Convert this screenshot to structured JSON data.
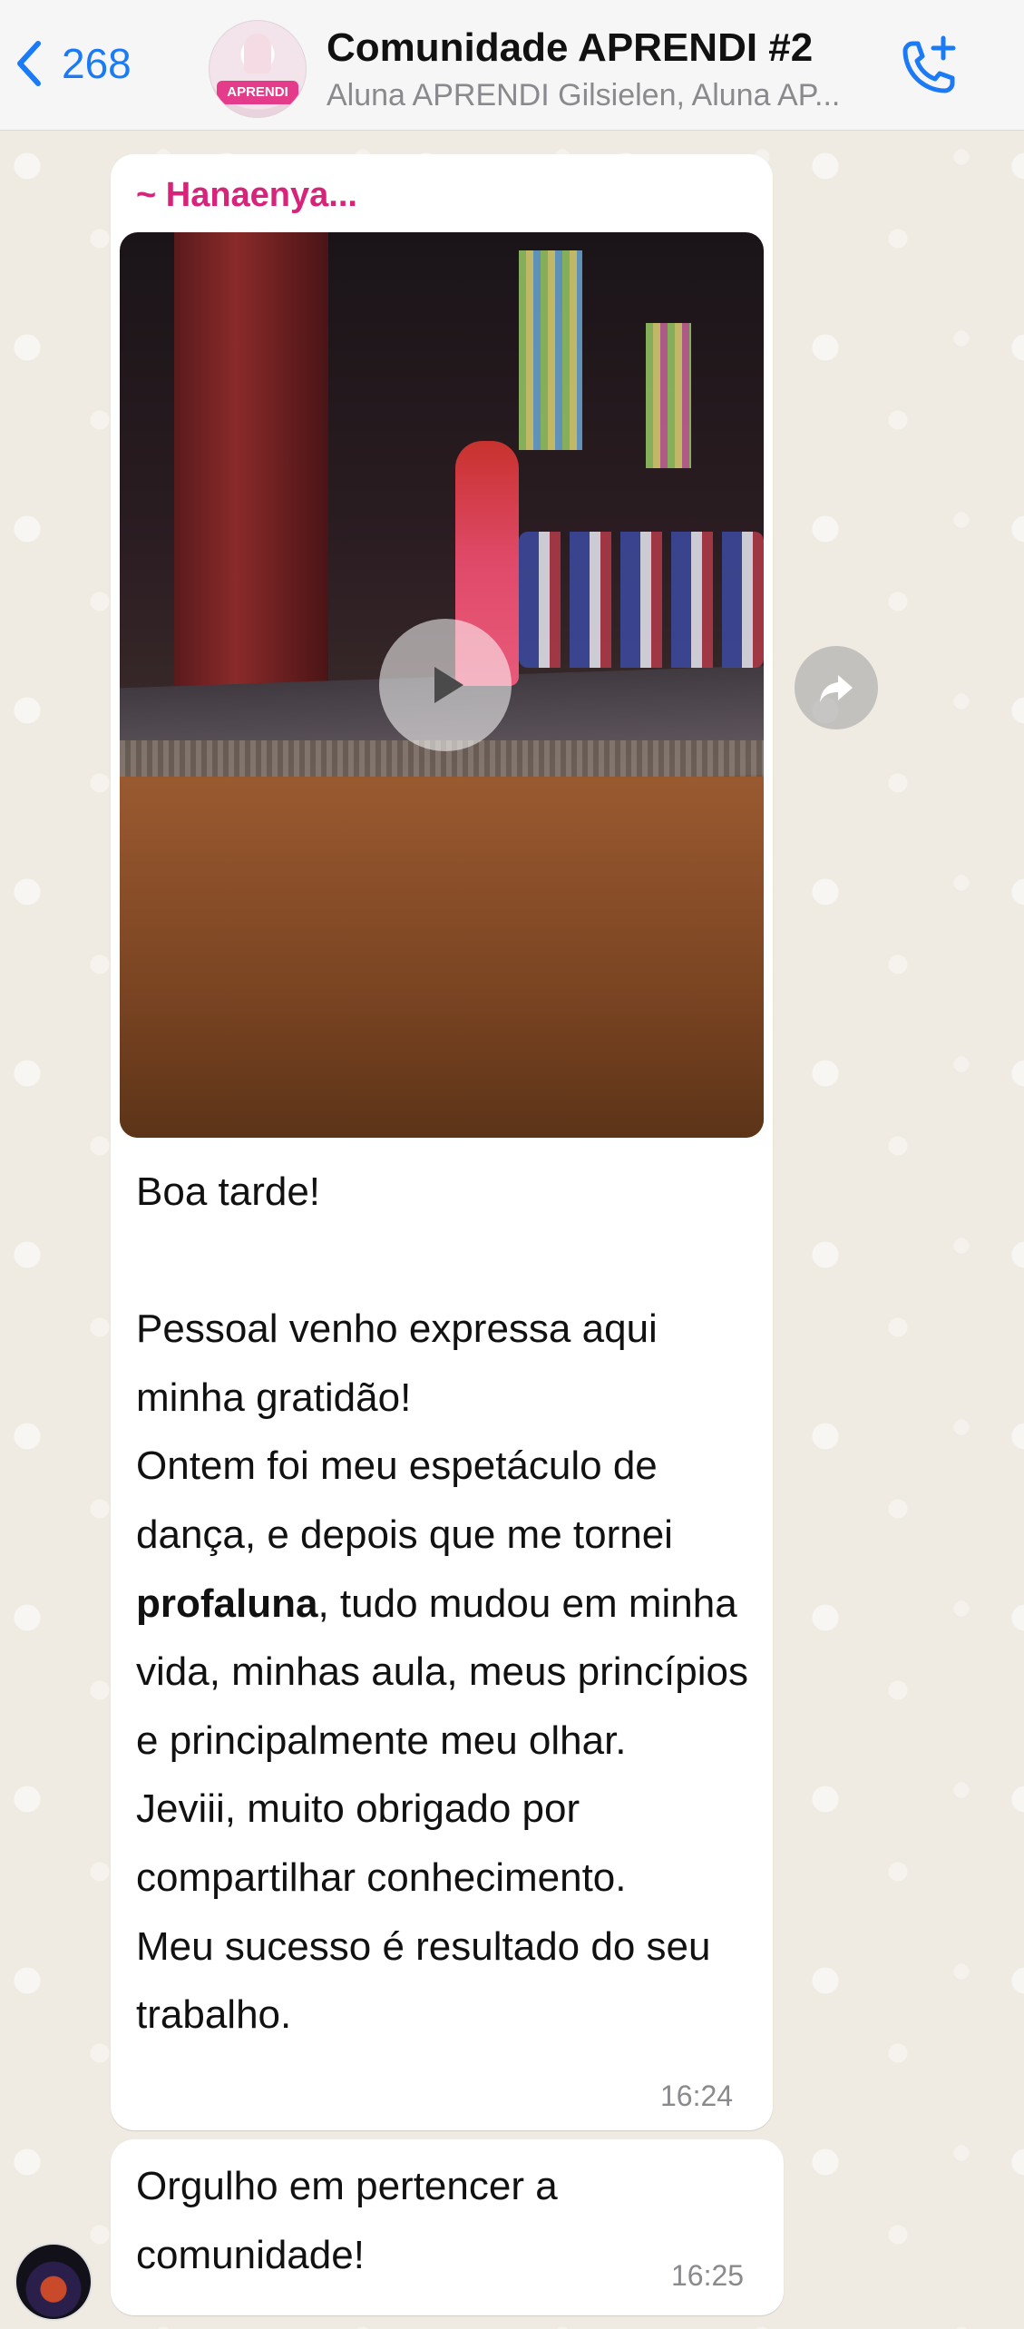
{
  "header": {
    "back_count": "268",
    "title": "Comunidade APRENDI #2",
    "subtitle": "Aluna APRENDI Gilsielen, Aluna AP...",
    "avatar_logo_text": "APRENDI"
  },
  "messages": [
    {
      "sender": "~ Hanaenya...",
      "media": "video",
      "paragraphs": [
        "Boa tarde!",
        "",
        "Pessoal venho expressa aqui minha gratidão!",
        "Ontem foi meu espetáculo de dança, e depois que me tornei",
        "Jeviii, muito obrigado por compartilhar conhecimento.",
        "Meu sucesso é resultado do seu trabalho."
      ],
      "bold_word": "profaluna",
      "after_bold": ", tudo mudou em minha vida, minhas aula, meus princípios e principalmente meu olhar.",
      "time": "16:24"
    },
    {
      "text": "Orgulho em pertencer a comunidade!",
      "time": "16:25"
    }
  ],
  "colors": {
    "accent": "#1B7BF6",
    "sender": "#D6247A",
    "bubble": "#FFFFFF",
    "chat_bg": "#EFEAE2"
  },
  "icons": {
    "back": "chevron-left-icon",
    "call": "phone-plus-icon",
    "play": "play-icon",
    "forward": "forward-icon"
  }
}
